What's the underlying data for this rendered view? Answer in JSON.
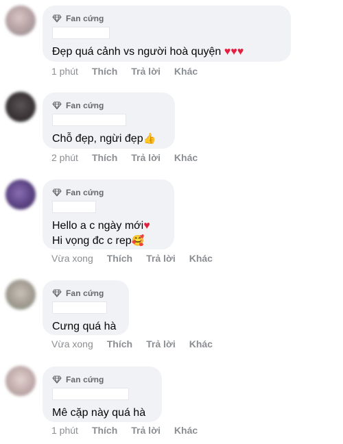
{
  "badge_label": "Fan cứng",
  "colors": {
    "bubble": "#f0f2f5",
    "secondary_text": "#65676b",
    "action_text": "#8a8d91",
    "heart": "#e41e3f"
  },
  "comments": [
    {
      "lines": [
        "Đẹp quá cảnh vs người hoà quyện"
      ],
      "reaction": "♥♥♥",
      "time": "1 phút",
      "like": "Thích",
      "reply": "Trả lời",
      "more": "Khác"
    },
    {
      "lines": [
        "Chỗ đẹp, ngừi đẹp"
      ],
      "reaction": "👍",
      "time": "2 phút",
      "like": "Thích",
      "reply": "Trả lời",
      "more": "Khác"
    },
    {
      "lines": [
        "Hello a c ngày mới",
        "Hi vọng đc c rep"
      ],
      "reaction": "♥",
      "reaction2": "🥰",
      "time": "Vừa xong",
      "like": "Thích",
      "reply": "Trả lời",
      "more": "Khác"
    },
    {
      "lines": [
        "Cưng quá hà"
      ],
      "time": "Vừa xong",
      "like": "Thích",
      "reply": "Trả lời",
      "more": "Khác"
    },
    {
      "lines": [
        "Mê cặp này quá hà"
      ],
      "time": "1 phút",
      "like": "Thích",
      "reply": "Trả lời",
      "more": "Khác"
    }
  ]
}
